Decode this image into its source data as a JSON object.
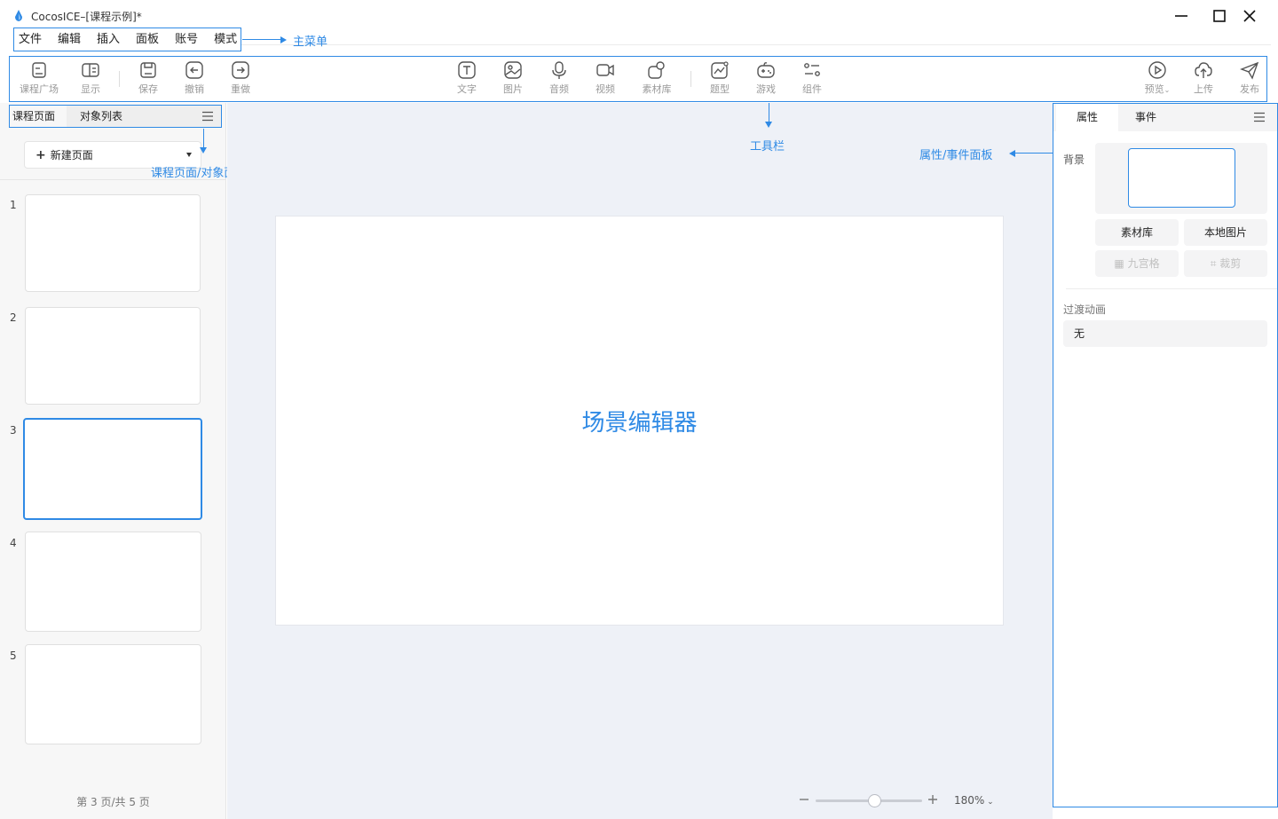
{
  "window": {
    "title": "CocosICE–[课程示例]*",
    "controls": [
      "minimize-icon",
      "maximize-icon",
      "close-icon"
    ]
  },
  "menu": {
    "items": [
      "文件",
      "编辑",
      "插入",
      "面板",
      "账号",
      "模式"
    ]
  },
  "toolbar": {
    "left": [
      {
        "label": "课程广场",
        "icon": "course-square-icon"
      },
      {
        "label": "显示",
        "icon": "display-icon"
      },
      {
        "label": "保存",
        "icon": "save-icon"
      },
      {
        "label": "撤销",
        "icon": "undo-icon"
      },
      {
        "label": "重做",
        "icon": "redo-icon"
      }
    ],
    "center": [
      {
        "label": "文字",
        "icon": "text-icon"
      },
      {
        "label": "图片",
        "icon": "image-icon"
      },
      {
        "label": "音频",
        "icon": "audio-icon"
      },
      {
        "label": "视频",
        "icon": "video-icon"
      },
      {
        "label": "素材库",
        "icon": "asset-library-icon"
      },
      {
        "label": "题型",
        "icon": "question-type-icon"
      },
      {
        "label": "游戏",
        "icon": "game-icon"
      },
      {
        "label": "组件",
        "icon": "component-icon"
      }
    ],
    "right": [
      {
        "label": "预览",
        "icon": "preview-icon"
      },
      {
        "label": "上传",
        "icon": "upload-icon"
      },
      {
        "label": "发布",
        "icon": "publish-icon"
      }
    ]
  },
  "left_panel": {
    "tabs": [
      "课程页面",
      "对象列表"
    ],
    "new_page_label": "新建页面",
    "pages": [
      "1",
      "2",
      "3",
      "4",
      "5"
    ],
    "active_page": "3",
    "page_indicator": "第 3 页/共 5 页"
  },
  "center": {
    "scene_label": "场景编辑器",
    "zoom": {
      "level": "180%",
      "minus": "−",
      "plus": "+",
      "value": 0.55
    }
  },
  "right_panel": {
    "tabs": [
      "属性",
      "事件"
    ],
    "background_label": "背景",
    "buttons": {
      "assets": "素材库",
      "local_image": "本地图片",
      "nine_grid": "九宫格",
      "crop": "裁剪"
    },
    "transition_label": "过渡动画",
    "transition_value": "无"
  },
  "annotations": {
    "main_menu": "主菜单",
    "toolbar": "工具栏",
    "left_panel": "课程页面/对象面板",
    "right_panel": "属性/事件面板"
  },
  "colors": {
    "accent": "#2f8ae5",
    "canvas_bg": "#eef1f7"
  }
}
